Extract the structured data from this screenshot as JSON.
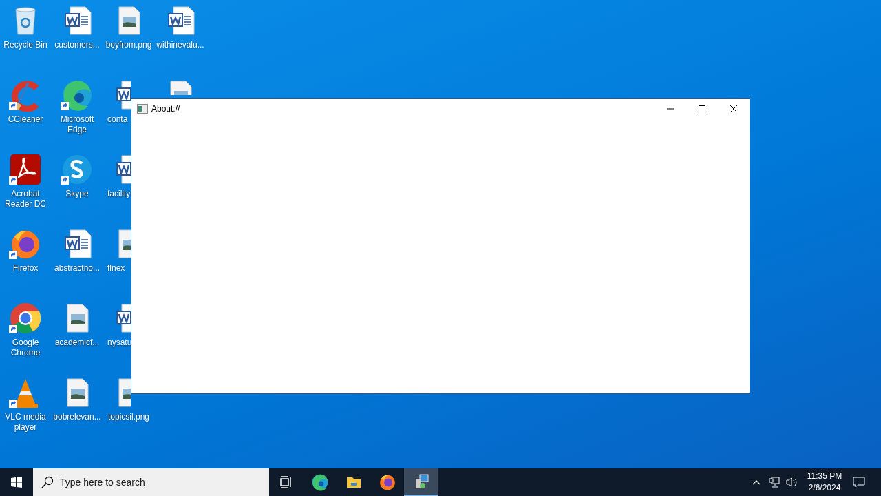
{
  "desktop_icons": [
    {
      "label": "Recycle Bin",
      "kind": "recycle",
      "shortcut": false
    },
    {
      "label": "customers...",
      "kind": "word",
      "shortcut": false
    },
    {
      "label": "boyfrom.png",
      "kind": "image",
      "shortcut": false
    },
    {
      "label": "withinevalu...",
      "kind": "word",
      "shortcut": false
    },
    {
      "label": "CCleaner",
      "kind": "ccleaner",
      "shortcut": true
    },
    {
      "label": "Microsoft Edge",
      "kind": "edge",
      "shortcut": true
    },
    {
      "label": "conta",
      "kind": "word",
      "shortcut": false
    },
    {
      "kind": "image"
    },
    {
      "label": "Acrobat Reader DC",
      "kind": "acrobat",
      "shortcut": true
    },
    {
      "label": "Skype",
      "kind": "skype",
      "shortcut": true
    },
    {
      "label": "facility",
      "kind": "word",
      "shortcut": false
    },
    {
      "label": "Firefox",
      "kind": "firefox",
      "shortcut": true
    },
    {
      "label": "abstractno...",
      "kind": "word",
      "shortcut": false
    },
    {
      "label": "flnex",
      "kind": "image",
      "shortcut": false
    },
    {
      "label": "Google Chrome",
      "kind": "chrome",
      "shortcut": true
    },
    {
      "label": "academicf...",
      "kind": "image",
      "shortcut": false
    },
    {
      "label": "nysatu",
      "kind": "word",
      "shortcut": false
    },
    {
      "label": "VLC media player",
      "kind": "vlc",
      "shortcut": true
    },
    {
      "label": "bobrelevan...",
      "kind": "image",
      "shortcut": false
    },
    {
      "label": "topicsil.png",
      "kind": "image",
      "shortcut": false
    }
  ],
  "window": {
    "title": "About://"
  },
  "taskbar": {
    "search_placeholder": "Type here to search",
    "apps": [
      {
        "kind": "taskview",
        "selected": false
      },
      {
        "kind": "edge",
        "selected": false
      },
      {
        "kind": "explorer",
        "selected": false
      },
      {
        "kind": "firefox",
        "selected": false
      },
      {
        "kind": "installer",
        "selected": true
      }
    ],
    "time": "11:35 PM",
    "date": "2/6/2024"
  }
}
